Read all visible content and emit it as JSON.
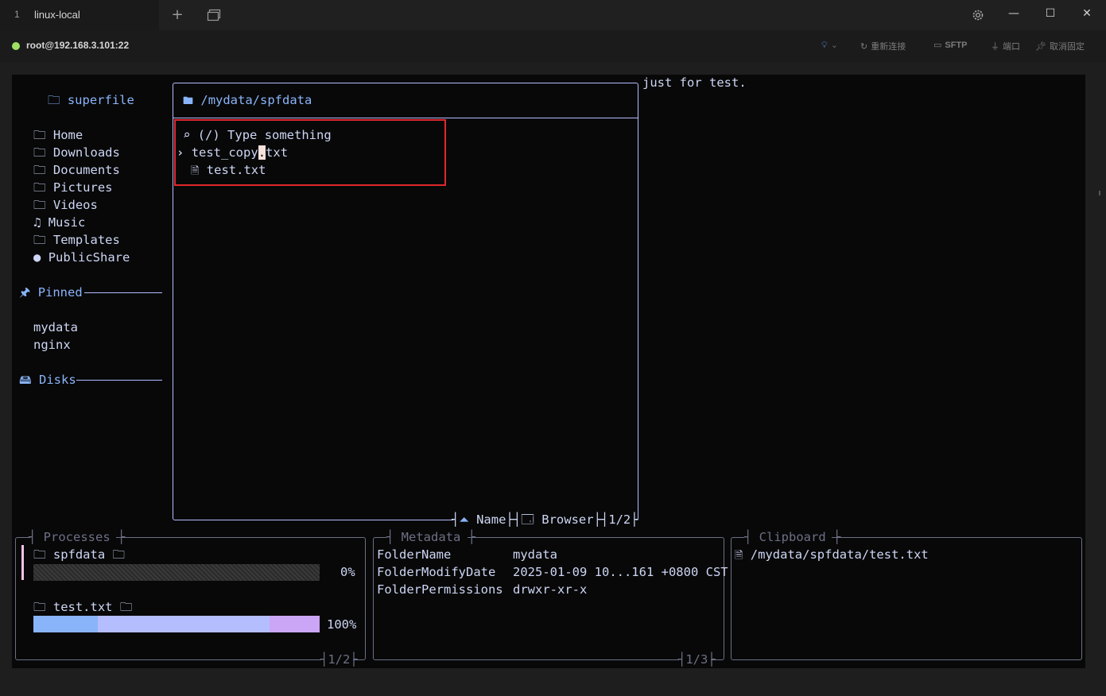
{
  "window": {
    "tab_number": "1",
    "tab_title": "linux-local",
    "new_tab_icon": "plus-icon",
    "tab_list_icon": "window-icon",
    "settings_icon": "gear-icon"
  },
  "connection": {
    "host": "root@192.168.3.101:22",
    "status_color": "#9ee064",
    "reconnect_label": "重新连接",
    "sftp_label": "SFTP",
    "port_label": "端口",
    "unpin_label": "取消固定"
  },
  "sidebar": {
    "title": "superfile",
    "well_known": [
      {
        "label": "Home",
        "icon": "folder-icon"
      },
      {
        "label": "Downloads",
        "icon": "folder-icon"
      },
      {
        "label": "Documents",
        "icon": "folder-icon"
      },
      {
        "label": "Pictures",
        "icon": "folder-icon"
      },
      {
        "label": "Videos",
        "icon": "folder-icon"
      },
      {
        "label": "Music",
        "icon": "music-icon"
      },
      {
        "label": "Templates",
        "icon": "folder-icon"
      },
      {
        "label": "PublicShare",
        "icon": "globe-icon"
      }
    ],
    "pinned_title": "Pinned",
    "pinned": [
      "mydata",
      "nginx"
    ],
    "disks_title": "Disks"
  },
  "file_panel": {
    "path": "/mydata/spfdata",
    "search_prefix": "(/)",
    "search_placeholder": "Type something",
    "rename_before": "test_copy",
    "rename_cursor": ".",
    "rename_after": "txt",
    "files": [
      "test.txt"
    ],
    "sort_label": "Name",
    "mode_label": "Browser",
    "page": "1/2"
  },
  "preview": {
    "text": "just for test."
  },
  "processes": {
    "title": "Processes",
    "items": [
      {
        "name": "spfdata",
        "percent": "0%",
        "progress": 0
      },
      {
        "name": "test.txt",
        "percent": "100%",
        "progress": 1
      }
    ],
    "page": "1/2"
  },
  "metadata": {
    "title": "Metadata",
    "rows": [
      {
        "key": "FolderName",
        "value": "mydata"
      },
      {
        "key": "FolderModifyDate",
        "value": "2025-01-09 10...161 +0800 CST"
      },
      {
        "key": "FolderPermissions",
        "value": "drwxr-xr-x"
      }
    ],
    "page": "1/3"
  },
  "clipboard": {
    "title": "Clipboard",
    "items": [
      "/mydata/spfdata/test.txt"
    ]
  },
  "colors": {
    "accent": "#b4befe",
    "blue": "#89b4fa",
    "progress_mauve": "#cba6f7"
  }
}
